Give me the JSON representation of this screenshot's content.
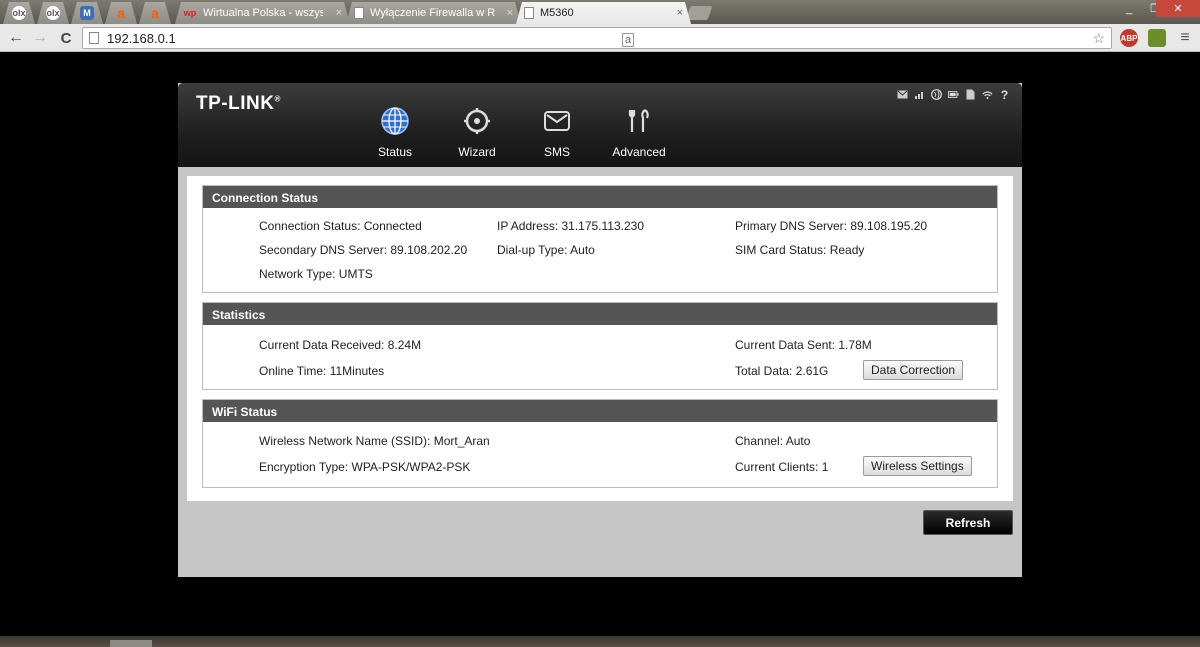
{
  "browser": {
    "tabs": [
      {
        "label": "",
        "icon": "olx-icon",
        "color": "#ffffff",
        "text": "olx"
      },
      {
        "label": "",
        "icon": "olx-icon",
        "color": "#ffffff",
        "text": "olx"
      },
      {
        "label": "",
        "icon": "gmail-icon",
        "color": "#3b6fb6",
        "text": "M"
      },
      {
        "label": "",
        "icon": "allegro-icon",
        "color": "#ff5a00",
        "text": "a"
      },
      {
        "label": "",
        "icon": "allegro-icon",
        "color": "#ff5a00",
        "text": "a"
      },
      {
        "label": "Wirtualna Polska - wszystk",
        "icon": "wp-icon",
        "color": "#d71f26",
        "text": "wp"
      },
      {
        "label": "Wyłączenie Firewalla w Ro",
        "icon": "page-icon",
        "color": "#ffffff",
        "text": ""
      },
      {
        "label": "M5360",
        "icon": "page-icon",
        "color": "#ffffff",
        "text": ""
      }
    ],
    "close_glyph": "×",
    "url": "192.168.0.1",
    "back_glyph": "←",
    "forward_glyph": "→",
    "reload_glyph": "C",
    "star_glyph": "☆",
    "translate_glyph": "a",
    "ext_abp": "ABP",
    "win_minimize": "_",
    "win_restore": "❐",
    "win_close": "✕"
  },
  "router": {
    "logo": "TP-LINK",
    "logo_mark": "®",
    "nav": [
      {
        "label": "Status",
        "icon": "globe-icon",
        "active": true
      },
      {
        "label": "Wizard",
        "icon": "wizard-icon",
        "active": false
      },
      {
        "label": "SMS",
        "icon": "envelope-icon",
        "active": false
      },
      {
        "label": "Advanced",
        "icon": "tools-icon",
        "active": false
      }
    ],
    "status_icons": [
      "sms-icon",
      "signal-icon",
      "internet-icon",
      "battery-icon",
      "sim-icon",
      "wifi-icon",
      "help-icon"
    ],
    "help_glyph": "?",
    "connection": {
      "title": "Connection Status",
      "status": "Connection Status:  Connected",
      "ip": "IP Address:  31.175.113.230",
      "primary_dns": "Primary DNS Server:  89.108.195.20",
      "secondary_dns": "Secondary DNS Server:  89.108.202.20",
      "dialup": "Dial-up Type:  Auto",
      "sim": "SIM Card Status:  Ready",
      "network": "Network Type:  UMTS"
    },
    "statistics": {
      "title": "Statistics",
      "received": "Current Data Received:  8.24M",
      "sent": "Current Data Sent:  1.78M",
      "online": "Online Time:  11Minutes",
      "total": "Total Data:  2.61G",
      "button": "Data Correction"
    },
    "wifi": {
      "title": "WiFi Status",
      "ssid": "Wireless Network Name (SSID):  Mort_Aran",
      "channel": "Channel:  Auto",
      "encryption": "Encryption Type:  WPA-PSK/WPA2-PSK",
      "clients": "Current Clients:  1",
      "button": "Wireless Settings"
    },
    "refresh": "Refresh"
  }
}
